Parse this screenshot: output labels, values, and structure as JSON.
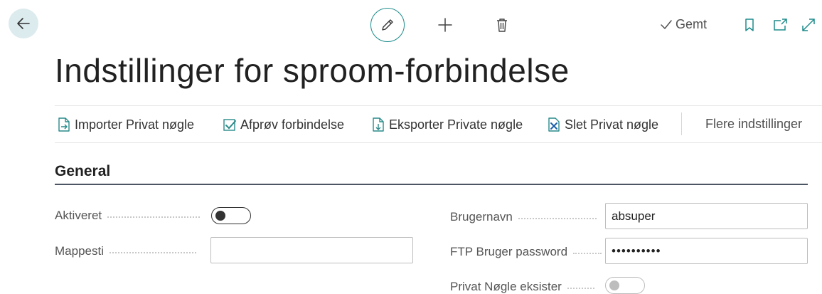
{
  "header": {
    "back_icon": "arrow-left-icon",
    "edit_icon": "pencil-icon",
    "new_icon": "plus-icon",
    "delete_icon": "trash-icon",
    "saved_label": "Gemt",
    "bookmark_icon": "bookmark-icon",
    "open_new_window_icon": "open-in-new-window-icon",
    "expand_icon": "expand-icon"
  },
  "page": {
    "title": "Indstillinger for sproom-forbindelse"
  },
  "actions": {
    "import": "Importer Privat nøgle",
    "test": "Afprøv forbindelse",
    "export": "Eksporter Private nøgle",
    "delete": "Slet Privat nøgle",
    "more": "Flere indstillinger"
  },
  "section": {
    "title": "General"
  },
  "fields": {
    "enabled": {
      "label": "Aktiveret",
      "value": false
    },
    "folder_path": {
      "label": "Mappesti",
      "value": ""
    },
    "username": {
      "label": "Brugernavn",
      "value": "absuper"
    },
    "ftp_password": {
      "label": "FTP Bruger password",
      "value": "••••••••••"
    },
    "private_key_exists": {
      "label": "Privat Nøgle eksister",
      "value": false
    }
  },
  "colors": {
    "accent": "#1e8c8c",
    "back_button_bg": "#dcebee",
    "action_icon": "#2a8a8a"
  }
}
